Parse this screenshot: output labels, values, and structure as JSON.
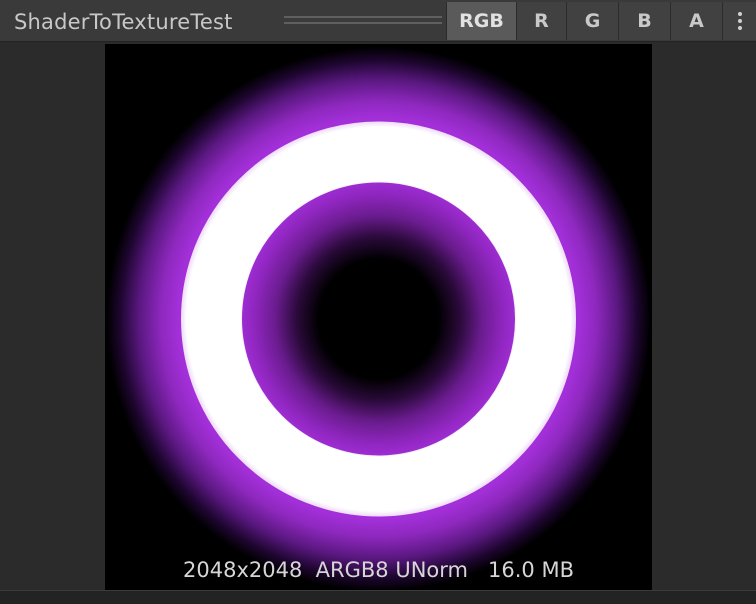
{
  "window": {
    "title": "ShaderToTextureTest"
  },
  "channel_tabs": [
    {
      "label": "RGB",
      "active": true
    },
    {
      "label": "R",
      "active": false
    },
    {
      "label": "G",
      "active": false
    },
    {
      "label": "B",
      "active": false
    },
    {
      "label": "A",
      "active": false
    }
  ],
  "menu": {
    "icon": "kebab-menu-icon"
  },
  "preview": {
    "texture_info": "2048x2048  ARGB8 UNorm   16.0 MB",
    "colors": {
      "background": "#000000",
      "glow": "#a22fd8",
      "ring": "#ffffff"
    }
  }
}
